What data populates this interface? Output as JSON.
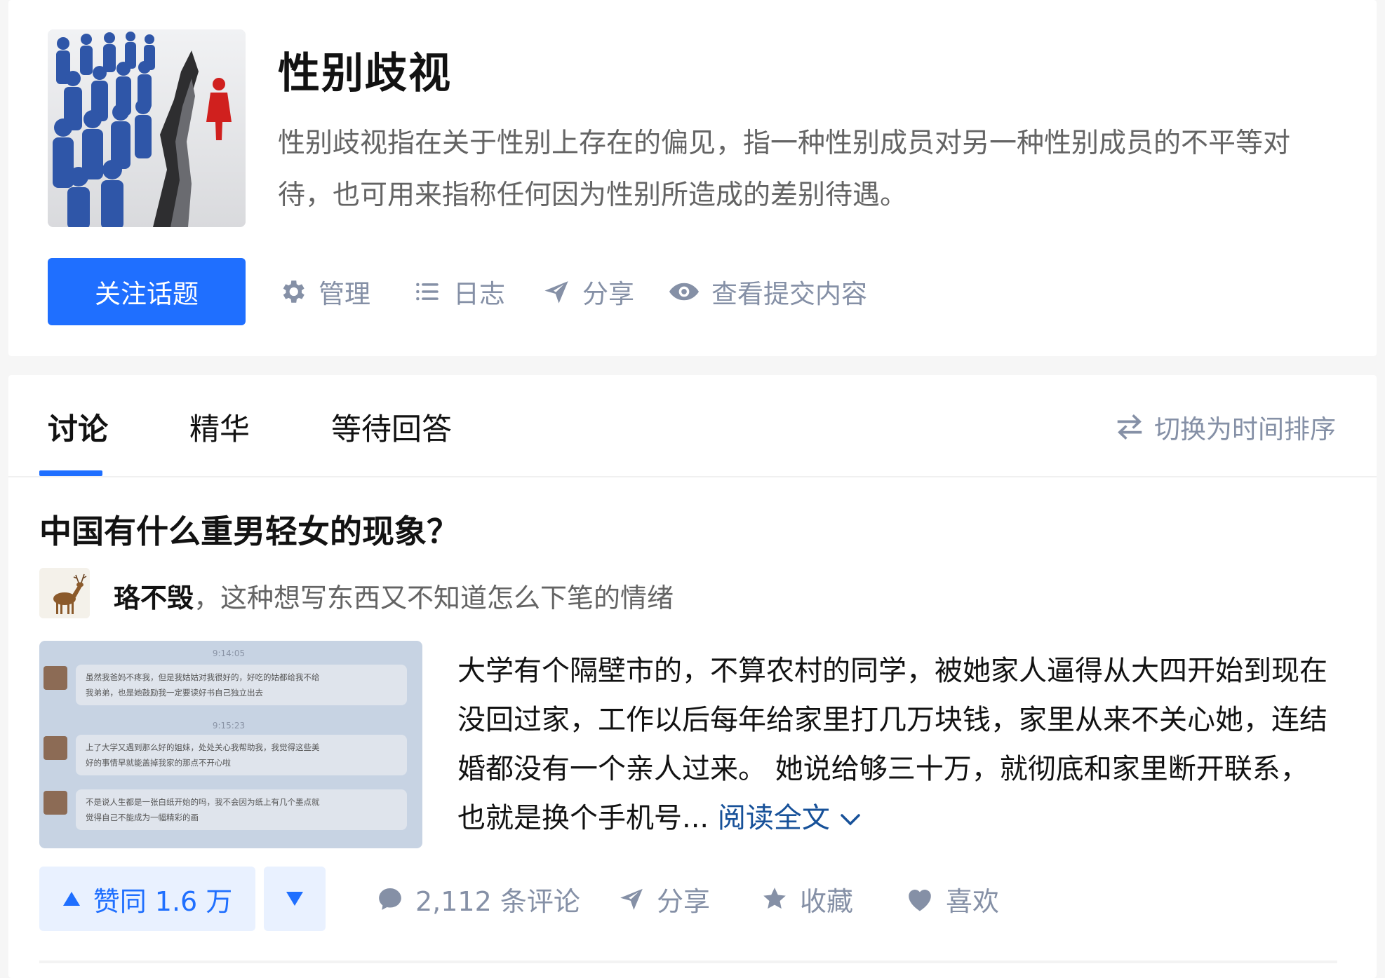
{
  "topic": {
    "title": "性别歧视",
    "description": "性别歧视指在关于性别上存在的偏见，指一种性别成员对另一种性别成员的不平等对待，也可用来指称任何因为性别所造成的差别待遇。",
    "image_icon": "crowd-split-image",
    "follow_label": "关注话题",
    "actions": {
      "manage": "管理",
      "log": "日志",
      "share": "分享",
      "view_submissions": "查看提交内容"
    }
  },
  "tabs": {
    "discussion": "讨论",
    "featured": "精华",
    "waiting": "等待回答",
    "active": "讨论"
  },
  "sort_toggle": "切换为时间排序",
  "feed": {
    "question": "中国有什么重男轻女的现象？",
    "author_name": "珞不毁",
    "author_sep": "，",
    "author_bio": "这种想写东西又不知道怎么下笔的情绪",
    "excerpt": "大学有个隔壁市的，不算农村的同学，被她家人逼得从大四开始到现在没回过家，工作以后每年给家里打几万块钱，家里从来不关心她，连结婚都没有一个亲人过来。 她说给够三十万，就彻底和家里断开联系，也就是换个手机号...",
    "read_more": "阅读全文",
    "thumbnail": {
      "times": [
        "9:14:05",
        "9:15:23"
      ],
      "messages": [
        "虽然我爸妈不疼我，但是我姑姑对我很好的，好吃的姑都给我不给我弟弟，也是她鼓励我一定要读好书自己独立出去",
        "上了大学又遇到那么好的姐妹，处处关心我帮助我，我觉得这些美好的事情早就能盖掉我家的那点不开心啦",
        "不是说人生都是一张白纸开始的吗，我不会因为纸上有几个墨点就觉得自己不能成为一幅精彩的画"
      ]
    },
    "vote_up": "赞同 1.6 万",
    "comments": "2,112 条评论",
    "share": "分享",
    "collect": "收藏",
    "like": "喜欢"
  },
  "colors": {
    "brand_blue": "#1f6fff",
    "muted_gray": "#8590a6",
    "link_blue": "#175199"
  }
}
